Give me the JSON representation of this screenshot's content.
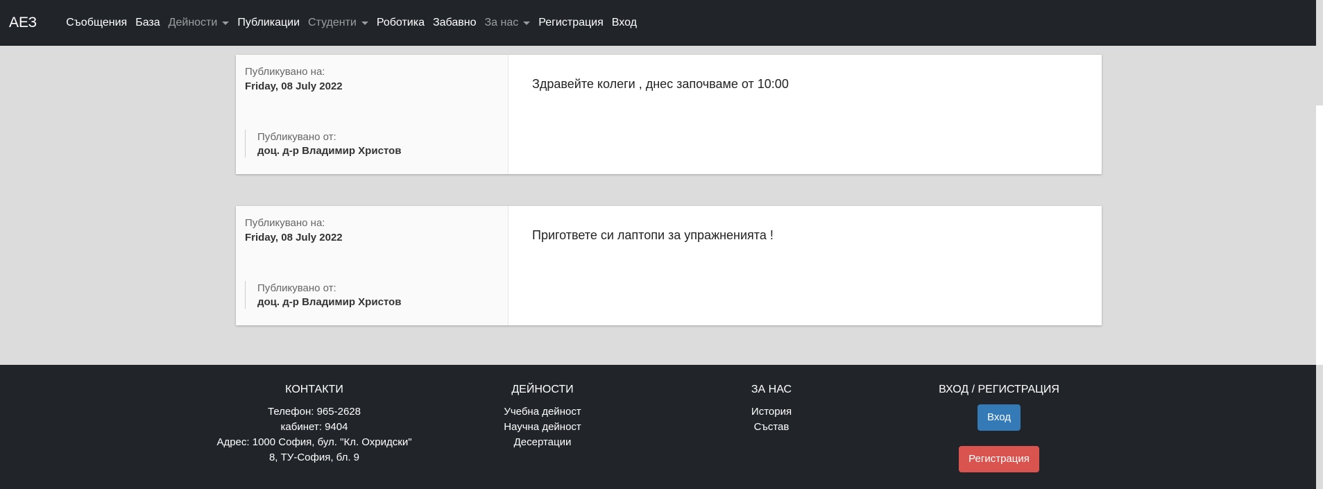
{
  "nav": {
    "brand": "АЕЗ",
    "items": [
      {
        "label": "Съобщения"
      },
      {
        "label": "База"
      },
      {
        "label": "Дейности"
      },
      {
        "label": "Публикации"
      },
      {
        "label": "Студенти"
      },
      {
        "label": "Роботика"
      },
      {
        "label": "Забавно"
      },
      {
        "label": "За нас"
      },
      {
        "label": "Регистрация"
      },
      {
        "label": "Вход"
      }
    ]
  },
  "posts": [
    {
      "published_on_label": "Публикувано на:",
      "date": "Friday, 08 July 2022",
      "published_by_label": "Публикувано от:",
      "author": "доц. д-р Владимир Христов",
      "text": "Здравейте колеги , днес започваме от 10:00"
    },
    {
      "published_on_label": "Публикувано на:",
      "date": "Friday, 08 July 2022",
      "published_by_label": "Публикувано от:",
      "author": "доц. д-р Владимир Христов",
      "text": "Пригответе си лаптопи за упражненията !"
    }
  ],
  "footer": {
    "contacts": {
      "title": "КОНТАКТИ",
      "lines": [
        "Телефон: 965-2628",
        "кабинет: 9404",
        "Адрес: 1000 София, бул. \"Кл. Охридски\"",
        "8, ТУ-София, бл. 9"
      ]
    },
    "activities": {
      "title": "ДЕЙНОСТИ",
      "links": [
        "Учебна дейност",
        "Научна дейност",
        "Десертации"
      ]
    },
    "about": {
      "title": "ЗА НАС",
      "links": [
        "История",
        "Състав"
      ]
    },
    "auth": {
      "title": "ВХОД / РЕГИСТРАЦИЯ",
      "login_label": "Вход",
      "register_label": "Регистрация"
    }
  },
  "colors": {
    "navbar_bg": "#212529",
    "page_bg": "#dcdcdc",
    "login_btn": "#337ab7",
    "register_btn": "#d9534f"
  }
}
